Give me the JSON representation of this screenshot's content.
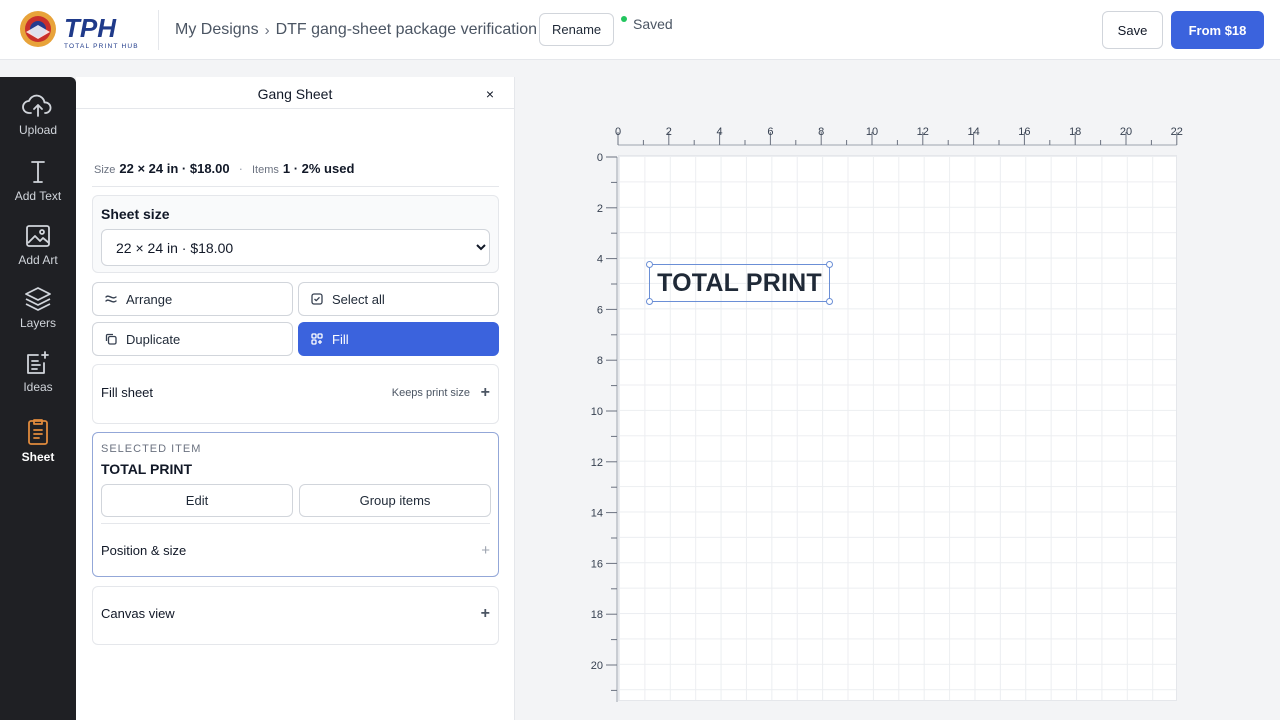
{
  "header": {
    "logo_text": "TPH",
    "logo_tagline": "TOTAL PRINT HUB",
    "breadcrumb": {
      "parent": "My Designs",
      "current": "DTF gang-sheet package verification"
    },
    "rename_label": "Rename",
    "status_label": "Saved",
    "save_label": "Save",
    "cta_label": "From $18",
    "accent_color": "#3b63dd"
  },
  "rail": {
    "items": [
      {
        "label": "Upload",
        "icon": "cloud-upload-icon"
      },
      {
        "label": "Add Text",
        "icon": "text-icon"
      },
      {
        "label": "Add Art",
        "icon": "image-icon"
      },
      {
        "label": "Layers",
        "icon": "layers-icon"
      },
      {
        "label": "Ideas",
        "icon": "ideas-icon"
      },
      {
        "label": "Sheet",
        "icon": "sheet-icon",
        "active": true
      }
    ]
  },
  "panel": {
    "title": "Gang Sheet",
    "close_glyph": "×",
    "summary": {
      "size_key": "Size",
      "size_value": "22 × 24 in · $18.00",
      "separator": "·",
      "items_key": "Items",
      "items_value": "1 · 2% used"
    },
    "sheet_size": {
      "label": "Sheet size",
      "selected": "22 × 24 in · $18.00"
    },
    "actions": {
      "arrange": "Arrange",
      "select_all": "Select all",
      "duplicate": "Duplicate",
      "fill": "Fill"
    },
    "fill_sheet": {
      "title": "Fill sheet",
      "hint": "Keeps print size"
    },
    "selected_item": {
      "caption": "SELECTED ITEM",
      "name": "TOTAL PRINT",
      "edit_label": "Edit",
      "group_label": "Group items",
      "position_size": "Position & size"
    },
    "canvas_view": {
      "title": "Canvas view"
    }
  },
  "canvas": {
    "x_ticks": [
      "0",
      "2",
      "4",
      "6",
      "8",
      "10",
      "12",
      "14",
      "16",
      "18",
      "20",
      "22"
    ],
    "y_ticks": [
      "0",
      "2",
      "4",
      "6",
      "8",
      "10",
      "12",
      "14",
      "16",
      "18",
      "20"
    ],
    "item_text": "TOTAL PRINT"
  }
}
